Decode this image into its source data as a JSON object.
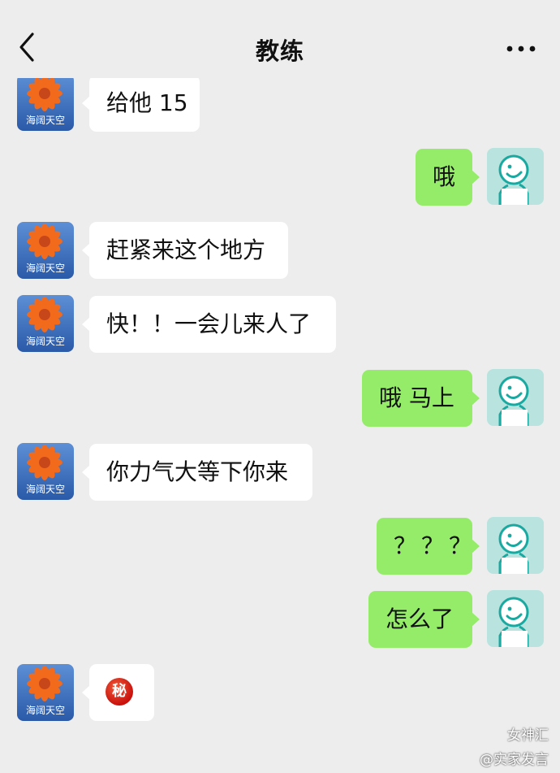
{
  "header": {
    "back_icon": "chevron-left-icon",
    "title": "教练",
    "more_icon": "more-horizontal-icon"
  },
  "contact_avatar": {
    "label": "海阔天空",
    "icon": "flower-avatar"
  },
  "self_avatar": {
    "icon": "smiley-avatar"
  },
  "colors": {
    "incoming_bubble": "#ffffff",
    "outgoing_bubble": "#95ec69",
    "background": "#ededed"
  },
  "messages": [
    {
      "from": "contact",
      "text": "给他 15"
    },
    {
      "from": "me",
      "text": "哦"
    },
    {
      "from": "contact",
      "text": "赶紧来这个地方"
    },
    {
      "from": "contact",
      "text": "快！！一会儿来人了"
    },
    {
      "from": "me",
      "text": "哦 马上"
    },
    {
      "from": "contact",
      "text": "你力气大等下你来"
    },
    {
      "from": "me",
      "text": "？？？"
    },
    {
      "from": "me",
      "text": "怎么了"
    },
    {
      "from": "contact",
      "text": "秘",
      "icon": "secret-badge-icon"
    }
  ],
  "watermark": {
    "line1": "女神汇",
    "line2": "@实家发言"
  }
}
